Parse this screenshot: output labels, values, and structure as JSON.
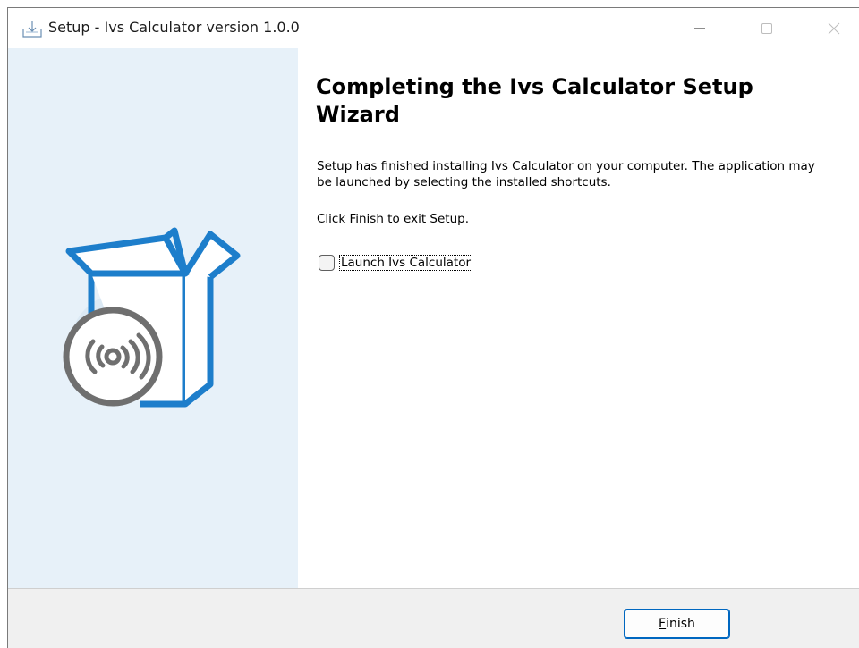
{
  "window": {
    "title": "Setup - Ivs Calculator version 1.0.0"
  },
  "controls": {
    "minimize_icon": "minimize-icon",
    "maximize_icon": "maximize-icon",
    "close_icon": "close-icon"
  },
  "wizard": {
    "heading": "Completing the Ivs Calculator Setup Wizard",
    "finished_text": "Setup has finished installing Ivs Calculator on your computer. The application may be launched by selecting the installed shortcuts.",
    "exit_text": "Click Finish to exit Setup.",
    "launch_checkbox_label": "Launch Ivs Calculator",
    "launch_checked": false
  },
  "footer": {
    "finish_label": "Finish",
    "finish_accel": "F",
    "finish_rest": "inish"
  },
  "colors": {
    "sidebar_bg": "#e7f1f9",
    "box_blue": "#1d7ecb",
    "disc_gray": "#6f6f6f",
    "button_accent": "#0067c0"
  }
}
